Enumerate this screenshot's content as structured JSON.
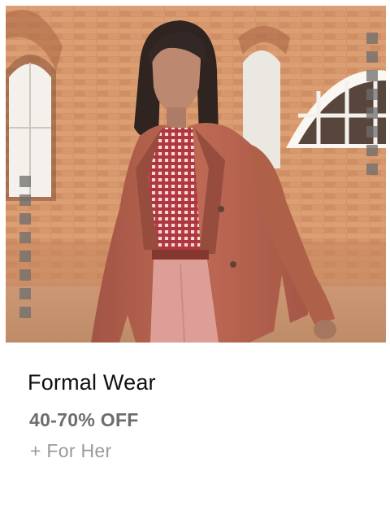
{
  "card": {
    "title": "Formal Wear",
    "discount": "40-70% OFF",
    "subtitle": "+ For Her"
  },
  "image": {
    "subject": "woman-in-rust-blazer",
    "colors": {
      "brick": "#c98a5c",
      "blazer": "#b05a48",
      "shirt": "#b3313e",
      "trousers": "#d99a94"
    }
  },
  "icons": {
    "indicator": "drag-dots-icon"
  }
}
